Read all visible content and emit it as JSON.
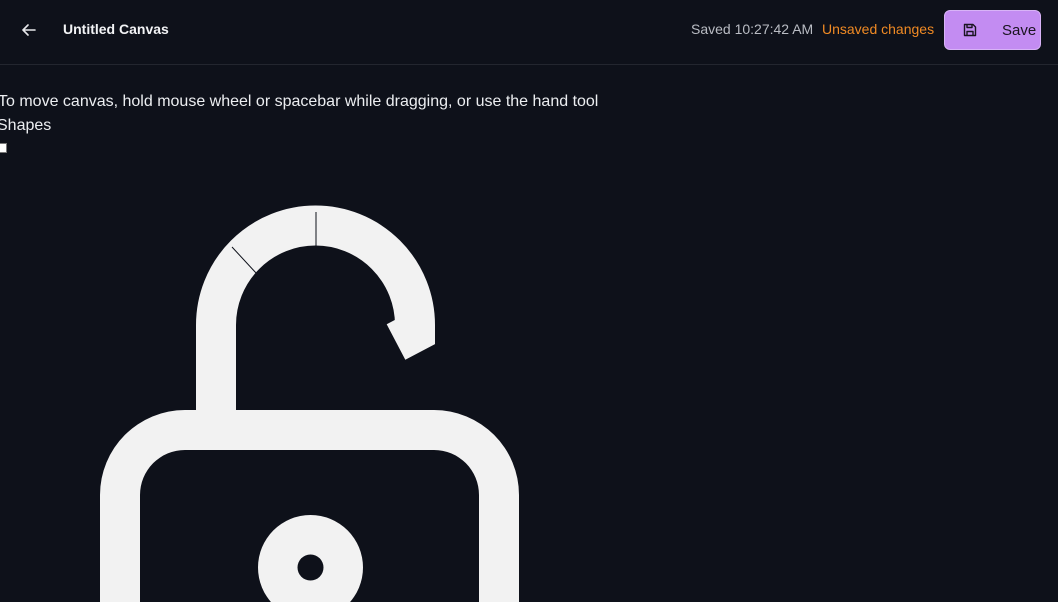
{
  "header": {
    "back_icon": "arrow-left-icon",
    "title": "Untitled Canvas",
    "saved_time": "Saved 10:27:42 AM",
    "unsaved_status": "Unsaved changes",
    "save_label": "Save",
    "save_icon": "floppy-disk-icon"
  },
  "canvas": {
    "hint": "To move canvas, hold mouse wheel or spacebar while dragging, or use the hand tool",
    "shapes_label": "Shapes",
    "shape_icon": "unlocked-padlock-icon"
  },
  "colors": {
    "background": "#0e111a",
    "accent": "#c38cf2",
    "warning": "#f08a24",
    "shape_fill": "#f2f2f2"
  }
}
